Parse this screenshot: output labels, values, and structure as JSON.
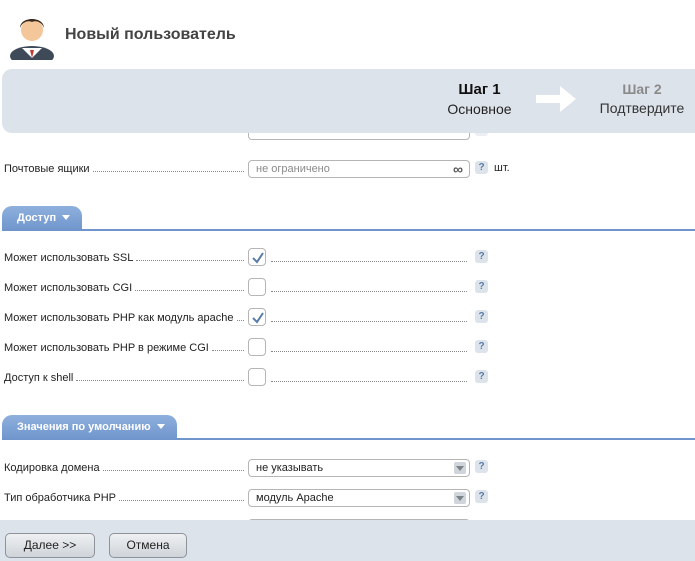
{
  "header": {
    "title": "Новый пользователь",
    "icon": "user-avatar-icon"
  },
  "steps": [
    {
      "number": "Шаг 1",
      "name": "Основное",
      "active": true
    },
    {
      "number": "Шаг 2",
      "name": "Подтвердите",
      "active": false
    }
  ],
  "mailboxes": {
    "label": "Почтовые ящики",
    "placeholder": "не ограничено",
    "unit": "шт."
  },
  "access": {
    "title": "Доступ",
    "items": [
      {
        "label": "Может использовать SSL",
        "checked": true
      },
      {
        "label": "Может использовать CGI",
        "checked": false
      },
      {
        "label": "Может использовать PHP как модуль apache",
        "checked": true
      },
      {
        "label": "Может использовать PHP в режиме CGI",
        "checked": false
      },
      {
        "label": "Доступ к shell",
        "checked": false
      }
    ]
  },
  "defaults": {
    "title": "Значения по умолчанию",
    "encoding": {
      "label": "Кодировка домена",
      "value": "не указывать"
    },
    "php_handler": {
      "label": "Тип обработчика PHP",
      "value": "модуль Apache"
    }
  },
  "help_symbol": "?",
  "buttons": {
    "next": "Далее >>",
    "cancel": "Отмена"
  },
  "colors": {
    "accent": "#6f95cc",
    "panel": "#dde3ea",
    "check": "#5a7ca8"
  }
}
